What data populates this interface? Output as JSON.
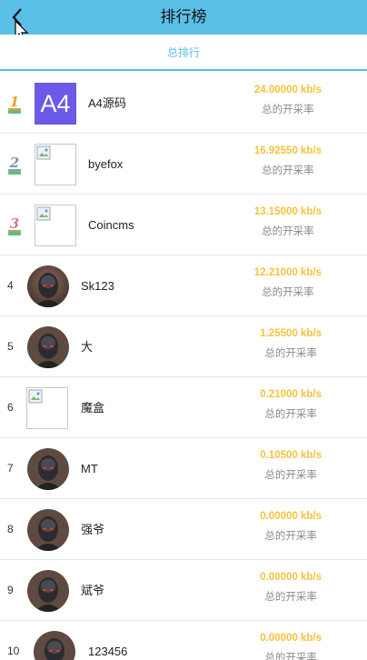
{
  "header": {
    "title": "排行榜",
    "back_icon": "chevron-left-icon"
  },
  "tabs": [
    {
      "label": "总排行",
      "active": true
    }
  ],
  "colors": {
    "accent": "#5bc0e8",
    "rate": "#f6c23e",
    "muted": "#8a8a8a"
  },
  "rate_label": "总的开采率",
  "rankings": [
    {
      "rank": "1",
      "rank_style": "medal-gold",
      "avatar": "A4",
      "avatar_type": "logo",
      "name": "A4源码",
      "rate": "24.00000 kb/s"
    },
    {
      "rank": "2",
      "rank_style": "medal-silver",
      "avatar": "",
      "avatar_type": "broken-image",
      "name": "byefox",
      "rate": "16.92550 kb/s"
    },
    {
      "rank": "3",
      "rank_style": "medal-bronze",
      "avatar": "",
      "avatar_type": "broken-image",
      "name": "Coincms",
      "rate": "13.15000 kb/s"
    },
    {
      "rank": "4",
      "rank_style": "number",
      "avatar": "",
      "avatar_type": "photo",
      "name": "Sk123",
      "rate": "12.21000 kb/s"
    },
    {
      "rank": "5",
      "rank_style": "number",
      "avatar": "",
      "avatar_type": "photo",
      "name": "大",
      "rate": "1.25500 kb/s"
    },
    {
      "rank": "6",
      "rank_style": "number",
      "avatar": "",
      "avatar_type": "broken-image",
      "name": "魔盒",
      "rate": "0.21000 kb/s"
    },
    {
      "rank": "7",
      "rank_style": "number",
      "avatar": "",
      "avatar_type": "photo",
      "name": "MT",
      "rate": "0.10500 kb/s"
    },
    {
      "rank": "8",
      "rank_style": "number",
      "avatar": "",
      "avatar_type": "photo",
      "name": "强爷",
      "rate": "0.00000 kb/s"
    },
    {
      "rank": "9",
      "rank_style": "number",
      "avatar": "",
      "avatar_type": "photo",
      "name": "斌爷",
      "rate": "0.00000 kb/s"
    },
    {
      "rank": "10",
      "rank_style": "number",
      "avatar": "",
      "avatar_type": "photo",
      "name": "123456",
      "rate": "0.00000 kb/s"
    }
  ]
}
